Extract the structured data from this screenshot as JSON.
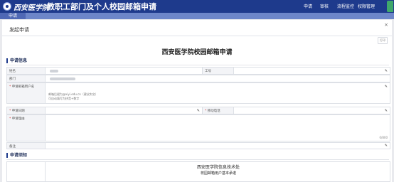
{
  "header": {
    "school_name": "西安医学院",
    "title": "教职工部门及个人校园邮箱申请",
    "nav": [
      "申请",
      "审核",
      "流程监控",
      "权限管理"
    ]
  },
  "subnav": {
    "tab": "申请"
  },
  "panel": {
    "title": "发起申请",
    "close": "×",
    "print_label": "打印",
    "form_title": "西安医学院校园邮箱申请"
  },
  "application": {
    "section_title": "申请信息",
    "name_label": "姓名",
    "id_label": "工号",
    "dept_label": "部门",
    "account_label": "申请邮箱用户名",
    "account_hint_1": "邮箱后缀为@xiyi.edu.cn（建议实名）",
    "account_hint_2": "可自动填写为拼音+数字",
    "date_label": "申请日期",
    "phone_label": "移动电话",
    "reason_label": "申请理由",
    "reason_counter": "0/800",
    "remark_label": "备注"
  },
  "notice": {
    "section_title": "申请须知",
    "org": "西安医学院信息技术处",
    "subtitle": "校园邮箱用户基本承诺"
  }
}
